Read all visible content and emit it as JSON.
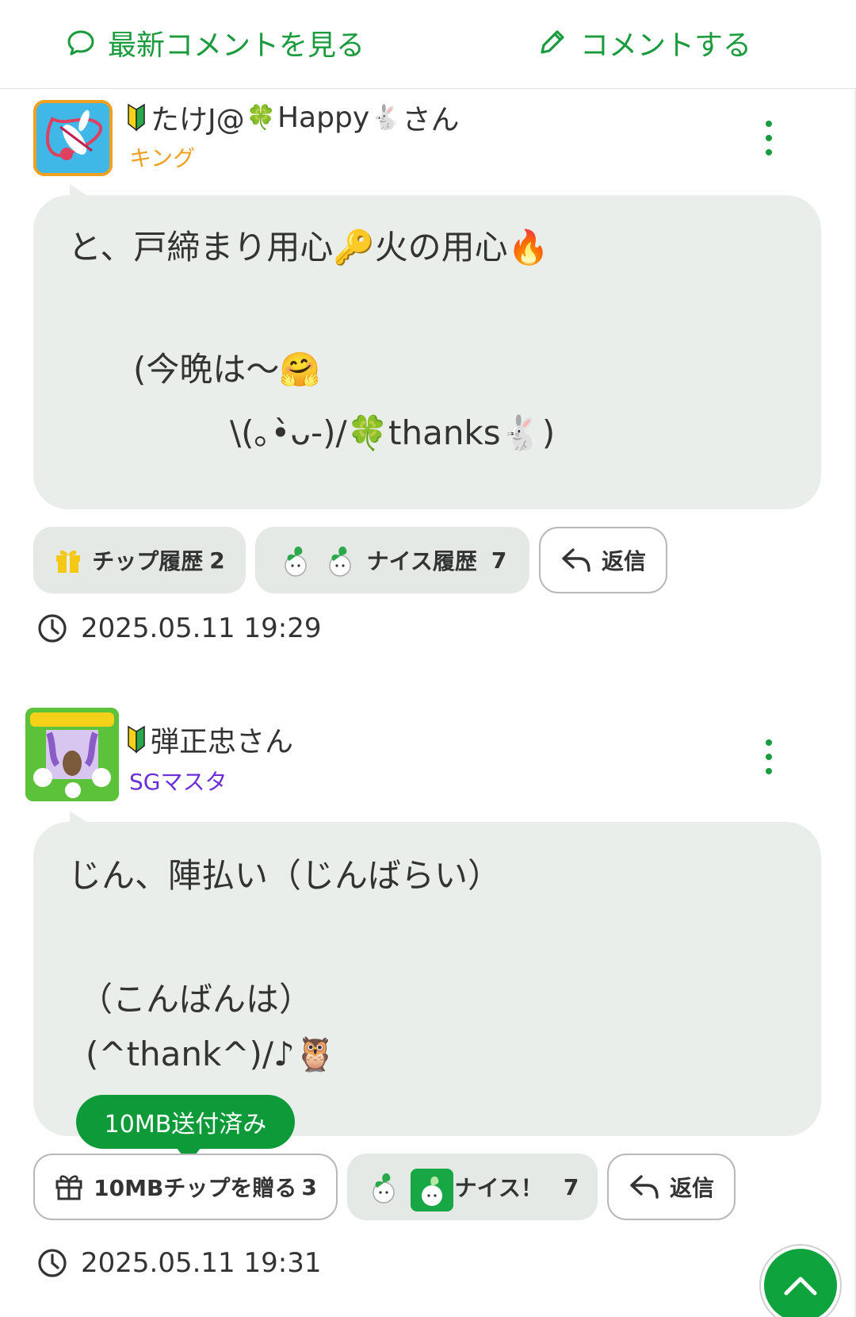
{
  "nav": {
    "latest_comments_label": "最新コメントを見る",
    "post_comment_label": "コメントする"
  },
  "comments": [
    {
      "user_name_pre": "たけJ@",
      "user_name_mid": "Happy",
      "user_name_suffix": "さん",
      "rank": "キング",
      "body_lines": [
        "と、戸締まり用心🔑火の用心🔥",
        "(今晩は〜🤗",
        "\\(｡•̀ᴗ-)/🍀thanks🐇)"
      ],
      "tip_label": "チップ履歴",
      "tip_count": "2",
      "nice_label": "ナイス履歴",
      "nice_count": "7",
      "reply_label": "返信",
      "timestamp": "2025.05.11 19:29"
    },
    {
      "user_name": "弾正忠さん",
      "rank": "SGマスタ",
      "body_lines": [
        "じん、陣払い（じんばらい）",
        "（こんばんは）",
        "(^thank^)/♪🦉"
      ],
      "tooltip": "10MB送付済み",
      "tip_label": "10MBチップを贈る",
      "tip_count": "3",
      "nice_label": "ナイス！",
      "nice_count": "7",
      "reply_label": "返信",
      "timestamp": "2025.05.11 19:31"
    }
  ],
  "colors": {
    "accent": "#1a9b3e",
    "bubble": "#e9eeeb",
    "rank_king": "#f0a020",
    "rank_sg": "#6a2fd6"
  },
  "icons": [
    "speech-bubble-icon",
    "pencil-icon",
    "beginner-mark-icon",
    "clover-icon",
    "rabbit-icon",
    "kebab-menu-icon",
    "gift-icon",
    "reply-icon",
    "clock-icon",
    "chevron-up-icon"
  ]
}
